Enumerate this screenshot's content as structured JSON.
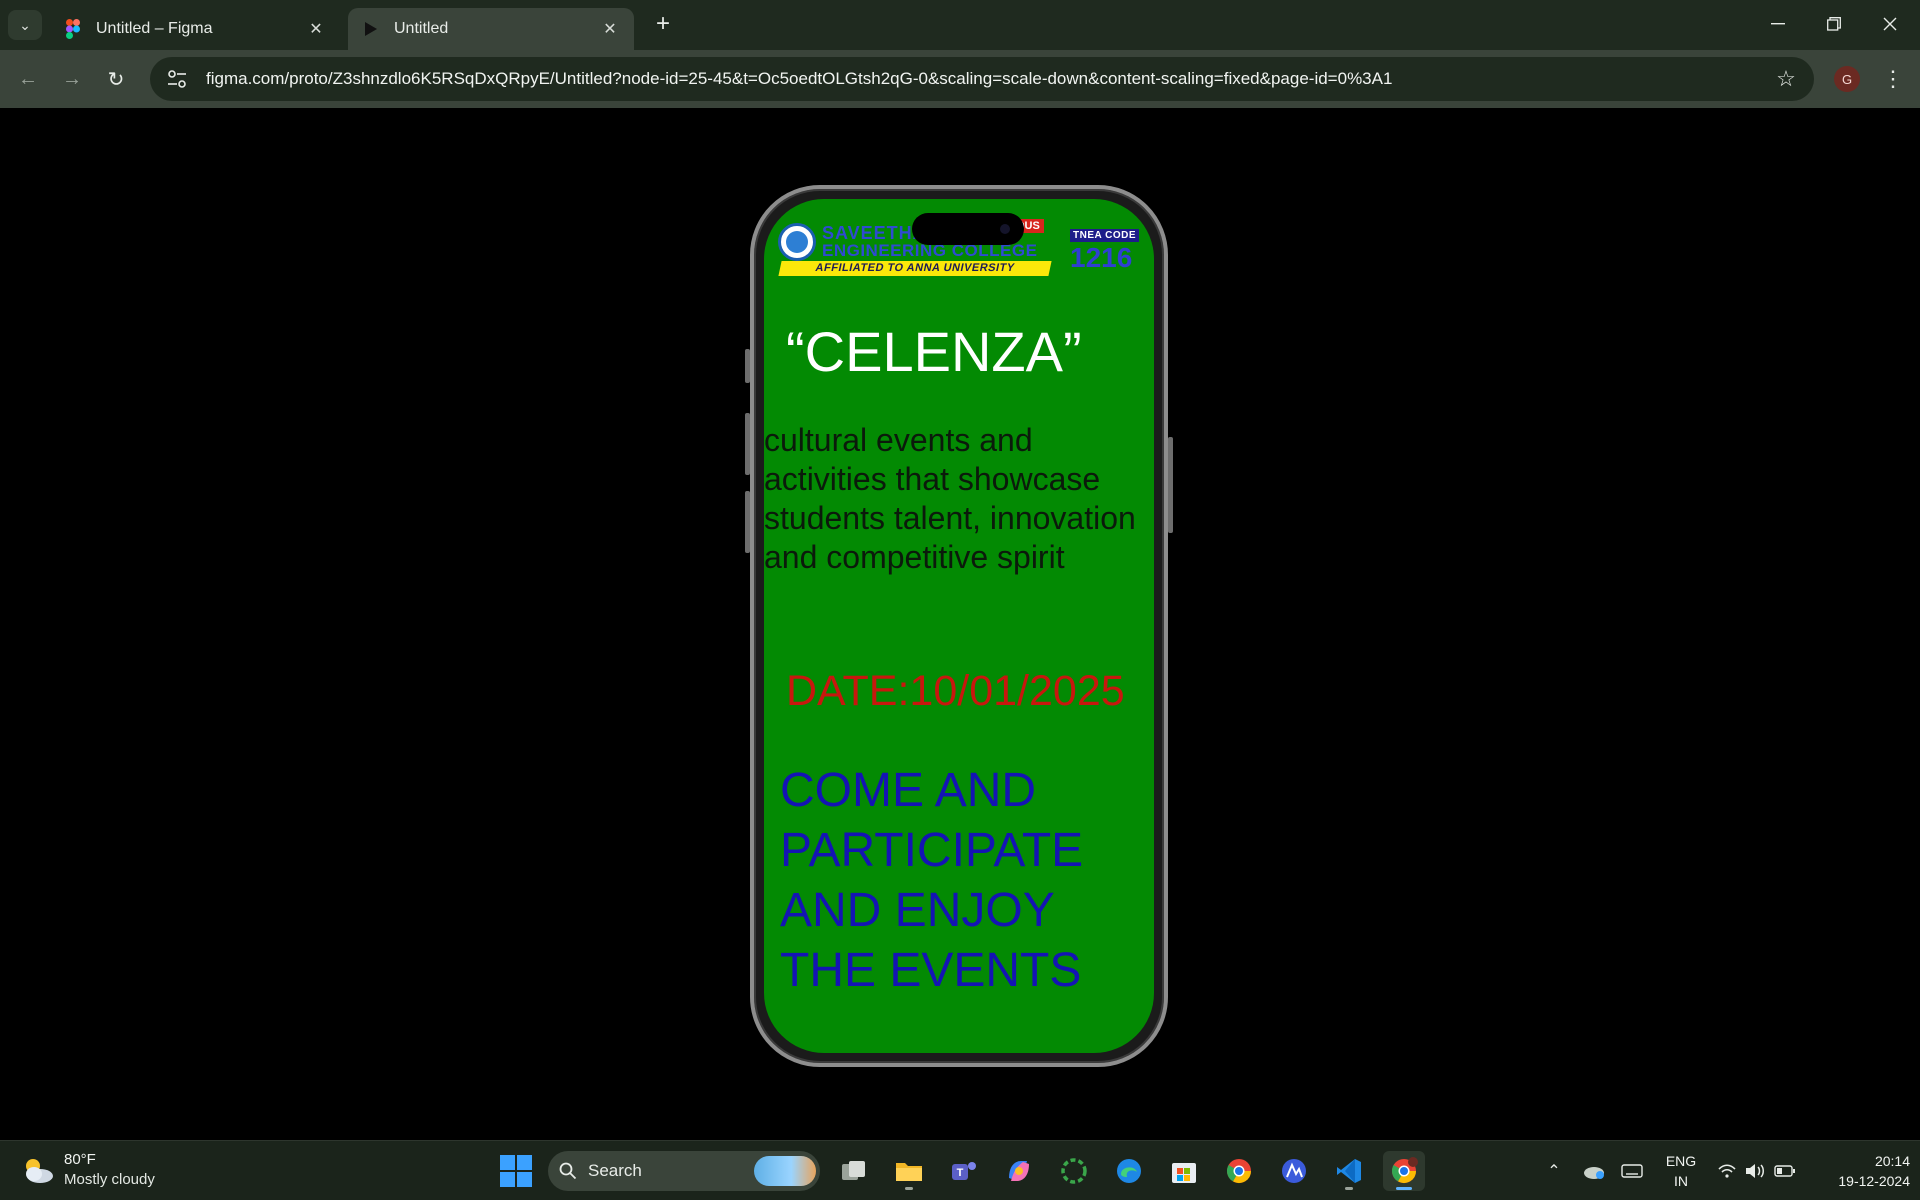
{
  "browser": {
    "tabs": [
      {
        "title": "Untitled – Figma",
        "active": false
      },
      {
        "title": "Untitled",
        "active": true
      }
    ],
    "url": "figma.com/proto/Z3shnzdlo6K5RSqDxQRpyE/Untitled?node-id=25-45&t=Oc5oedtOLGtsh2qG-0&scaling=scale-down&content-scaling=fixed&page-id=0%3A1",
    "profile_initial": "G"
  },
  "prototype": {
    "logo": {
      "line1": "SAVEETHA",
      "badge": "OUS",
      "line2": "ENGINEERING COLLEGE",
      "affiliation": "AFFILIATED TO ANNA UNIVERSITY",
      "tnea_label": "TNEA CODE",
      "tnea_code": "1216"
    },
    "headline": "“CELENZA”",
    "description": "cultural events and activities that showcase students talent, innovation and competitive spirit",
    "date": "DATE:10/01/2025",
    "cta": "COME AND PARTICIPATE AND ENJOY THE EVENTS",
    "colors": {
      "screen_bg": "#038a03",
      "headline": "#ffffff",
      "date": "#c8170e",
      "cta": "#1414b4"
    }
  },
  "taskbar": {
    "weather_temp": "80°F",
    "weather_condition": "Mostly cloudy",
    "search_label": "Search",
    "lang_top": "ENG",
    "lang_bottom": "IN",
    "time": "20:14",
    "date": "19-12-2024",
    "apps": [
      "task-view-icon",
      "file-explorer-icon",
      "teams-icon",
      "copilot-icon",
      "loading-app-icon",
      "edge-icon",
      "store-icon",
      "chrome-icon",
      "arc-app-icon",
      "vscode-icon",
      "chrome-profile-icon"
    ]
  }
}
